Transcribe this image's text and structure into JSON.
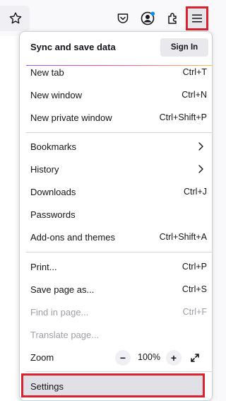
{
  "toolbar": {
    "icons": [
      "star-icon",
      "pocket-icon",
      "account-icon",
      "extensions-icon",
      "app-menu-icon"
    ]
  },
  "menu": {
    "sync_label": "Sync and save data",
    "sign_in": "Sign In",
    "items": [
      {
        "label": "New tab",
        "shortcut": "Ctrl+T"
      },
      {
        "label": "New window",
        "shortcut": "Ctrl+N"
      },
      {
        "label": "New private window",
        "shortcut": "Ctrl+Shift+P"
      },
      {
        "label": "Bookmarks",
        "shortcut": ""
      },
      {
        "label": "History",
        "shortcut": ""
      },
      {
        "label": "Downloads",
        "shortcut": "Ctrl+J"
      },
      {
        "label": "Passwords",
        "shortcut": ""
      },
      {
        "label": "Add-ons and themes",
        "shortcut": "Ctrl+Shift+A"
      },
      {
        "label": "Print...",
        "shortcut": "Ctrl+P"
      },
      {
        "label": "Save page as...",
        "shortcut": "Ctrl+S"
      },
      {
        "label": "Find in page...",
        "shortcut": "Ctrl+F"
      },
      {
        "label": "Translate page...",
        "shortcut": ""
      }
    ],
    "zoom": {
      "label": "Zoom",
      "minus": "−",
      "value": "100%",
      "plus": "+"
    },
    "settings": "Settings"
  },
  "colors": {
    "highlight": "#d9232e",
    "accent": "#0090ed"
  }
}
